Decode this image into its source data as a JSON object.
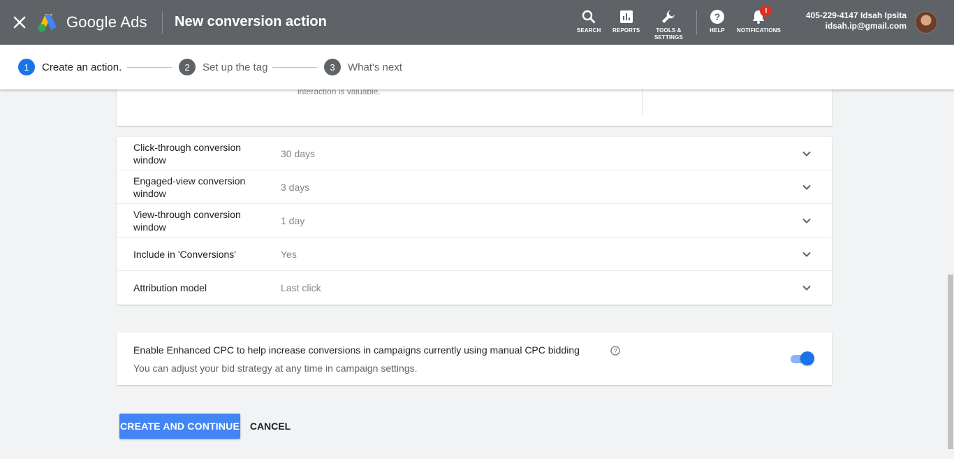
{
  "header": {
    "brand": "Google Ads",
    "title": "New conversion action",
    "tools": [
      {
        "label": "SEARCH",
        "icon": "search-icon"
      },
      {
        "label": "REPORTS",
        "icon": "reports-icon"
      },
      {
        "label_line1": "TOOLS &",
        "label_line2": "SETTINGS",
        "icon": "wrench-icon"
      },
      {
        "label": "HELP",
        "icon": "help-icon"
      },
      {
        "label": "NOTIFICATIONS",
        "icon": "bell-icon",
        "badge": "!"
      }
    ],
    "account": {
      "line1": "405-229-4147 Idsah Ipsita",
      "line2": "idsah.ip@gmail.com"
    }
  },
  "stepper": {
    "steps": [
      {
        "number": "1",
        "label": "Create an action.",
        "active": true
      },
      {
        "number": "2",
        "label": "Set up the tag",
        "active": false
      },
      {
        "number": "3",
        "label": "What's next",
        "active": false
      }
    ]
  },
  "top_card": {
    "faded_text": "interaction is valuable."
  },
  "settings": {
    "rows": [
      {
        "label_line1": "Click-through conversion",
        "label_line2": "window",
        "value": "30 days"
      },
      {
        "label_line1": "Engaged-view conversion",
        "label_line2": "window",
        "value": "3 days"
      },
      {
        "label_line1": "View-through conversion",
        "label_line2": "window",
        "value": "1 day"
      },
      {
        "label_line1": "Include in 'Conversions'",
        "label_line2": "",
        "value": "Yes"
      },
      {
        "label_line1": "Attribution model",
        "label_line2": "",
        "value": "Last click"
      }
    ]
  },
  "ecpc": {
    "title": "Enable Enhanced CPC to help increase conversions in campaigns currently using manual CPC bidding",
    "subtitle": "You can adjust your bid strategy at any time in campaign settings.",
    "enabled": true
  },
  "actions": {
    "primary": "CREATE AND CONTINUE",
    "secondary": "CANCEL"
  },
  "colors": {
    "topbar": "#5f6368",
    "accent": "#1a73e8",
    "primary_button": "#4285f4",
    "badge": "#d93025"
  }
}
